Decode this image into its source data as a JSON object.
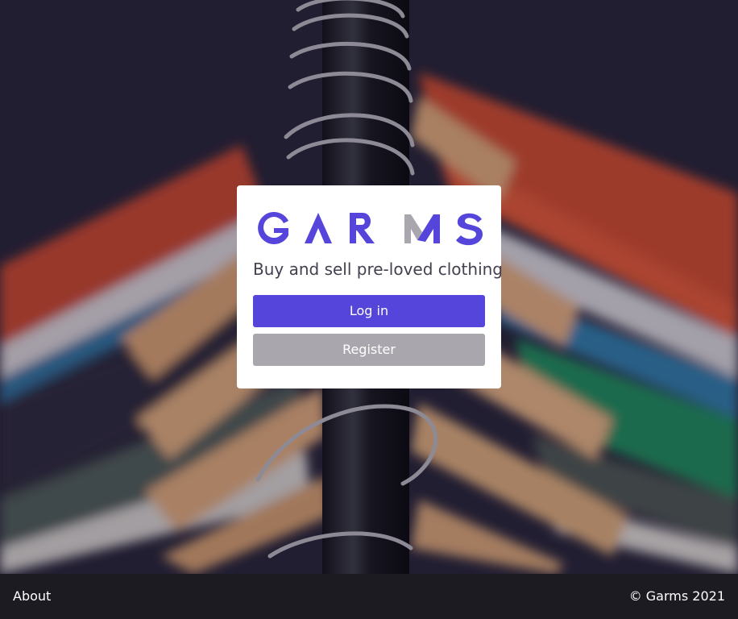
{
  "brand": {
    "logo_text": "GARMS",
    "primary_color": "#5545db",
    "accent_gray": "#a9a7ad"
  },
  "card": {
    "tagline": "Buy and sell pre-loved clothing",
    "login_label": "Log in",
    "register_label": "Register"
  },
  "footer": {
    "about_label": "About",
    "copyright": "© Garms 2021",
    "background": "#1c1b22"
  }
}
